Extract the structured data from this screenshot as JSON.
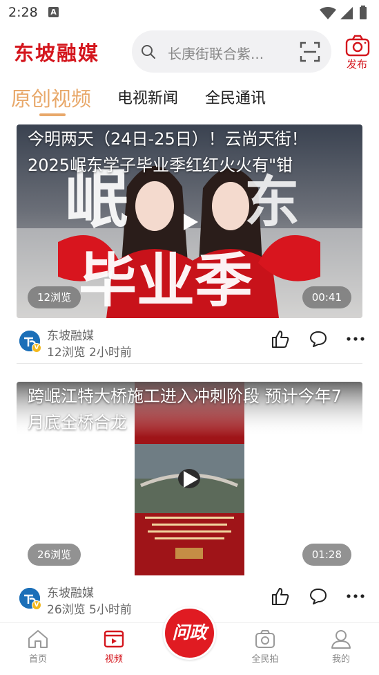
{
  "status_bar": {
    "time": "2:28",
    "notification_glyph": "A"
  },
  "header": {
    "logo": "东坡融媒",
    "search_placeholder": "长庚街联合紫...",
    "publish_label": "发布",
    "brand_color": "#d4161d"
  },
  "tabs": [
    {
      "label": "原创视频",
      "active": true
    },
    {
      "label": "电视新闻",
      "active": false
    },
    {
      "label": "全民通讯",
      "active": false
    }
  ],
  "videos": [
    {
      "title": "今明两天（24日-25日）！云尚天街！2025岷东学子毕业季红红火火有\"钳",
      "views_badge": "12浏览",
      "duration": "00:41",
      "source": "东坡融媒",
      "info": "12浏览 2小时前"
    },
    {
      "title": "跨岷江特大桥施工进入冲刺阶段 预计今年7月底全桥合龙",
      "views_badge": "26浏览",
      "duration": "01:28",
      "source": "东坡融媒",
      "info": "26浏览 5小时前"
    }
  ],
  "bottom_nav": {
    "items": [
      {
        "label": "首页",
        "icon": "home-icon",
        "active": false
      },
      {
        "label": "视频",
        "icon": "video-icon",
        "active": true
      },
      {
        "label": "全民拍",
        "icon": "camera-icon",
        "active": false
      },
      {
        "label": "我的",
        "icon": "profile-icon",
        "active": false
      }
    ],
    "center_label": "问政"
  },
  "accent_color": "#e8a86a"
}
